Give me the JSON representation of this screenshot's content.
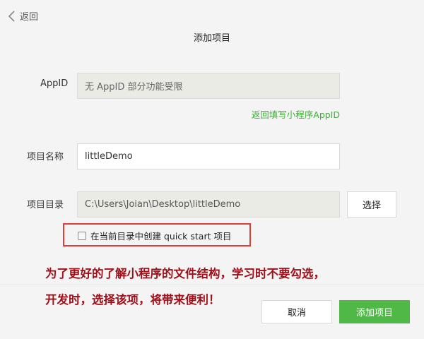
{
  "nav": {
    "back_label": "返回"
  },
  "header": {
    "title": "添加项目"
  },
  "form": {
    "appid": {
      "label": "AppID",
      "value": "无 AppID 部分功能受限",
      "link": "返回填写小程序AppID"
    },
    "project_name": {
      "label": "项目名称",
      "value": "littleDemo"
    },
    "project_dir": {
      "label": "项目目录",
      "value": "C:\\Users\\Joian\\Desktop\\littleDemo",
      "choose_label": "选择"
    },
    "quick_start": {
      "label": "在当前目录中创建 quick start 项目",
      "checked": false
    }
  },
  "annotation": {
    "line1": "为了更好的了解小程序的文件结构，学习时不要勾选，",
    "line2": "开发时，选择该项，将带来便利！",
    "color": "#a0101a",
    "highlight_color": "#e23b3b"
  },
  "footer": {
    "cancel_label": "取消",
    "add_label": "添加项目"
  },
  "colors": {
    "accent": "#4fb846",
    "link": "#3cb035",
    "background": "#f4f4f4"
  }
}
